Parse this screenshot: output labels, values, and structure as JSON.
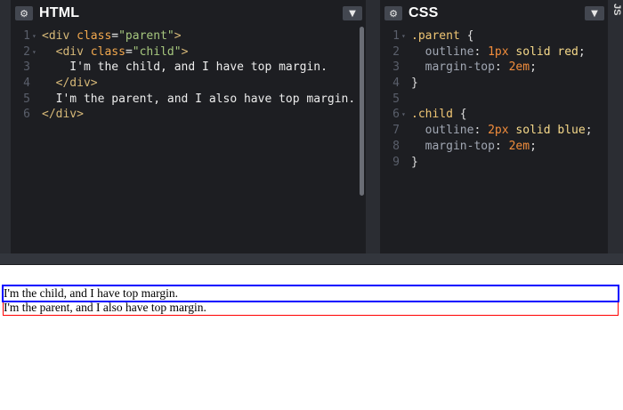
{
  "html_pane": {
    "title": "HTML",
    "settings_icon": "gear-icon",
    "collapse_icon": "chevron-down-icon",
    "lines": [
      {
        "n": "1",
        "fold": "▾",
        "tokens": [
          {
            "t": "<div ",
            "c": "tag"
          },
          {
            "t": "class",
            "c": "attr"
          },
          {
            "t": "=",
            "c": "plain"
          },
          {
            "t": "\"parent\"",
            "c": "str"
          },
          {
            "t": ">",
            "c": "tag"
          }
        ]
      },
      {
        "n": "2",
        "fold": "▾",
        "tokens": [
          {
            "t": "  <div ",
            "c": "tag"
          },
          {
            "t": "class",
            "c": "attr"
          },
          {
            "t": "=",
            "c": "plain"
          },
          {
            "t": "\"child\"",
            "c": "str"
          },
          {
            "t": ">",
            "c": "tag"
          }
        ]
      },
      {
        "n": "3",
        "fold": "",
        "tokens": [
          {
            "t": "    I'm the child, and I have top margin.",
            "c": "plain"
          }
        ]
      },
      {
        "n": "4",
        "fold": "",
        "tokens": [
          {
            "t": "  </div>",
            "c": "tag"
          }
        ]
      },
      {
        "n": "5",
        "fold": "",
        "tokens": [
          {
            "t": "  I'm the parent, and I also have top margin.",
            "c": "plain"
          }
        ]
      },
      {
        "n": "6",
        "fold": "",
        "tokens": [
          {
            "t": "</div>",
            "c": "tag"
          }
        ]
      }
    ]
  },
  "css_pane": {
    "title": "CSS",
    "settings_icon": "gear-icon",
    "collapse_icon": "chevron-down-icon",
    "lines": [
      {
        "n": "1",
        "fold": "▾",
        "tokens": [
          {
            "t": ".parent ",
            "c": "sel"
          },
          {
            "t": "{",
            "c": "punc"
          }
        ]
      },
      {
        "n": "2",
        "fold": "",
        "tokens": [
          {
            "t": "  outline",
            "c": "prop"
          },
          {
            "t": ": ",
            "c": "punc"
          },
          {
            "t": "1px",
            "c": "num"
          },
          {
            "t": " solid red",
            "c": "val"
          },
          {
            "t": ";",
            "c": "punc"
          }
        ]
      },
      {
        "n": "3",
        "fold": "",
        "tokens": [
          {
            "t": "  margin-top",
            "c": "prop"
          },
          {
            "t": ": ",
            "c": "punc"
          },
          {
            "t": "2em",
            "c": "num"
          },
          {
            "t": ";",
            "c": "punc"
          }
        ]
      },
      {
        "n": "4",
        "fold": "",
        "tokens": [
          {
            "t": "}",
            "c": "punc"
          }
        ]
      },
      {
        "n": "5",
        "fold": "",
        "tokens": []
      },
      {
        "n": "6",
        "fold": "▾",
        "tokens": [
          {
            "t": ".child ",
            "c": "sel"
          },
          {
            "t": "{",
            "c": "punc"
          }
        ]
      },
      {
        "n": "7",
        "fold": "",
        "tokens": [
          {
            "t": "  outline",
            "c": "prop"
          },
          {
            "t": ": ",
            "c": "punc"
          },
          {
            "t": "2px",
            "c": "num"
          },
          {
            "t": " solid blue",
            "c": "val"
          },
          {
            "t": ";",
            "c": "punc"
          }
        ]
      },
      {
        "n": "8",
        "fold": "",
        "tokens": [
          {
            "t": "  margin-top",
            "c": "prop"
          },
          {
            "t": ": ",
            "c": "punc"
          },
          {
            "t": "2em",
            "c": "num"
          },
          {
            "t": ";",
            "c": "punc"
          }
        ]
      },
      {
        "n": "9",
        "fold": "",
        "tokens": [
          {
            "t": "}",
            "c": "punc"
          }
        ]
      }
    ]
  },
  "js_tab": {
    "label": "JS"
  },
  "preview": {
    "child_text": "I'm the child, and I have top margin.",
    "parent_text": "I'm the parent, and I also have top margin."
  },
  "colors": {
    "editor_bg": "#1d1e22",
    "chrome_bg": "#2b2d33",
    "parent_outline": "#ff0000",
    "child_outline": "#0000ff"
  }
}
